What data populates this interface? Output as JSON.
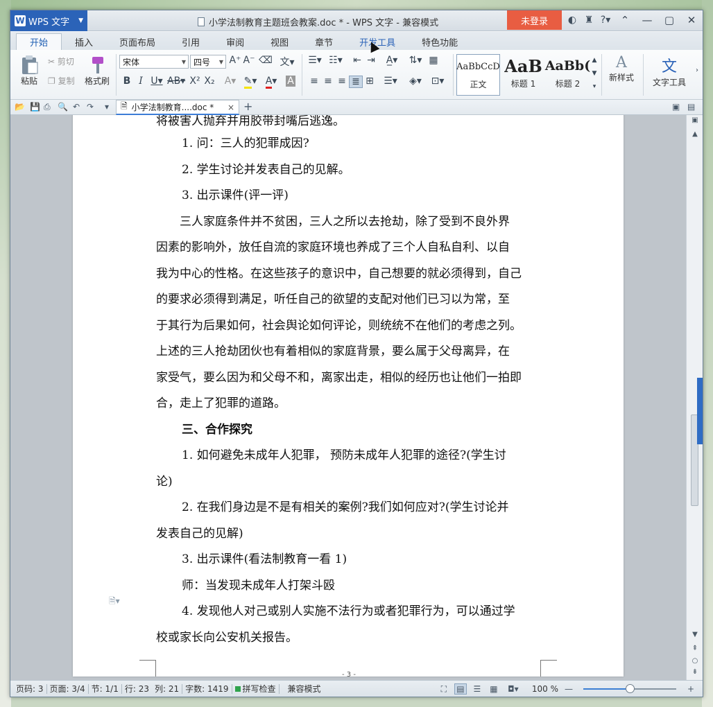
{
  "app": {
    "menu_label": "WPS 文字",
    "window_title": "小学法制教育主题班会教案.doc * - WPS 文字 - 兼容模式",
    "login_label": "未登录"
  },
  "tabs": [
    {
      "label": "开始",
      "active": true
    },
    {
      "label": "插入"
    },
    {
      "label": "页面布局"
    },
    {
      "label": "引用"
    },
    {
      "label": "审阅"
    },
    {
      "label": "视图"
    },
    {
      "label": "章节"
    },
    {
      "label": "开发工具"
    },
    {
      "label": "特色功能"
    }
  ],
  "ribbon": {
    "paste": "粘贴",
    "cut": "剪切",
    "copy": "复制",
    "format_painter": "格式刷",
    "font_name": "宋体",
    "font_size": "四号",
    "styles": [
      {
        "sample": "AaBbCcD",
        "label": "正文"
      },
      {
        "sample": "AaB",
        "label": "标题 1"
      },
      {
        "sample": "AaBb(",
        "label": "标题 2"
      }
    ],
    "new_style": "新样式",
    "text_tools": "文字工具"
  },
  "doc_tab": {
    "label": "小学法制教育....doc *",
    "close": "×",
    "new": "+"
  },
  "document": {
    "cut_top_line": "将被害人抛弃并用胶带封嘴后逃逸。",
    "line1": "1. 问：三人的犯罪成因?",
    "line2": "2. 学生讨论并发表自己的见解。",
    "line3": "3. 出示课件(评一评)",
    "para1": [
      "　　三人家庭条件并不贫困，三人之所以去抢劫，除了受到不良外界",
      "因素的影响外，放任自流的家庭环境也养成了三个人自私自利、以自",
      "我为中心的性格。在这些孩子的意识中，自己想要的就必须得到，自己",
      "的要求必须得到满足，听任自己的欲望的支配对他们已习以为常，至",
      "于其行为后果如何，社会舆论如何评论，则统统不在他们的考虑之列。",
      "上述的三人抢劫团伙也有着相似的家庭背景，要么属于父母离异，在",
      "家受气，要么因为和父母不和，离家出走，相似的经历也让他们一拍即",
      "合，走上了犯罪的道路。"
    ],
    "heading3": "三、合作探究",
    "q1a": "1. 如何避免未成年人犯罪， 预防未成年人犯罪的途径?(学生讨",
    "q1b": "论)",
    "q2a": "2. 在我们身边是不是有相关的案例?我们如何应对?(学生讨论并",
    "q2b": "发表自己的见解)",
    "q3": "3. 出示课件(看法制教育一看 1)",
    "q3b": "师：当发现未成年人打架斗殴",
    "q4a": "4. 发现他人对己或别人实施不法行为或者犯罪行为，可以通过学",
    "q4b": "校或家长向公安机关报告。",
    "page_number": "- 3 -"
  },
  "status": {
    "page_code": "页码: 3",
    "pages": "页面: 3/4",
    "section": "节: 1/1",
    "row": "行: 23",
    "col": "列: 21",
    "word_count": "字数: 1419",
    "spell_check": "拼写检查",
    "compat": "兼容模式",
    "zoom": "100 %",
    "zoom_fraction": 0.5
  }
}
